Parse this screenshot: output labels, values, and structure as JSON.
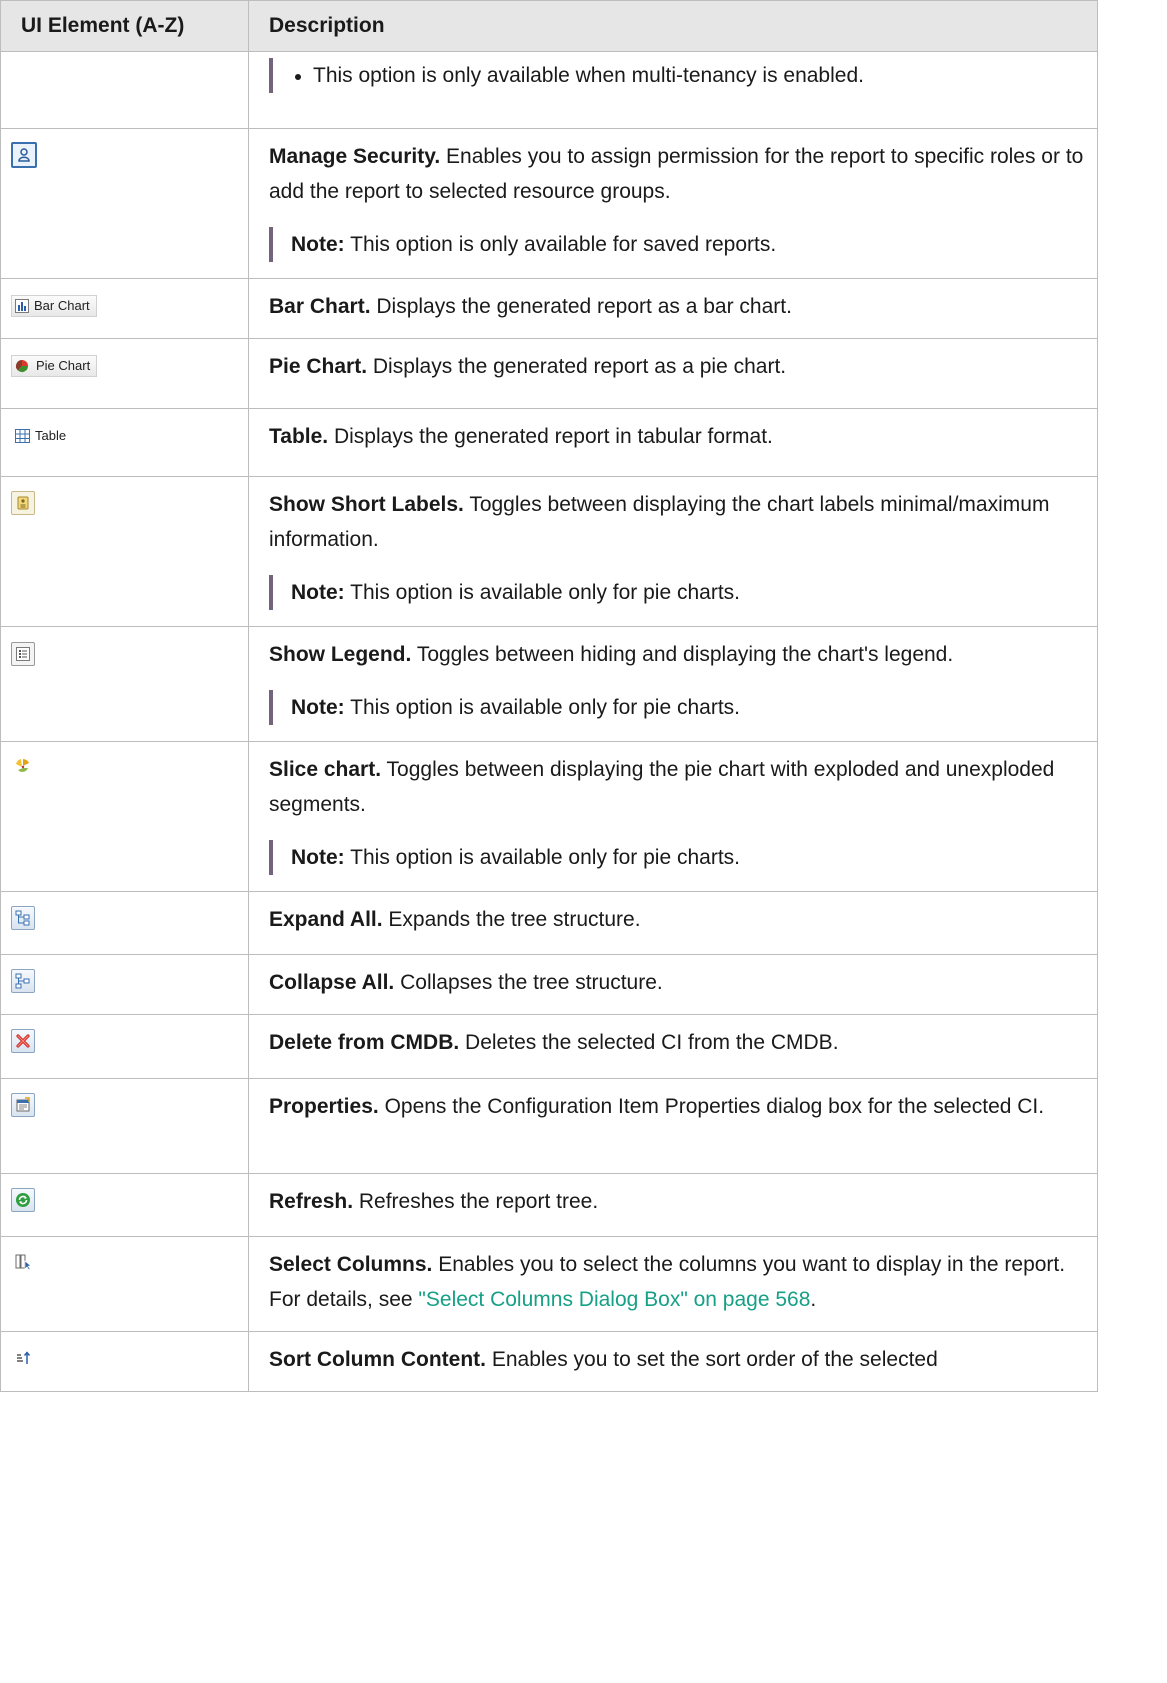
{
  "header": {
    "col1": "UI Element (A-Z)",
    "col2": "Description"
  },
  "rows": [
    {
      "note": "This option is only available when multi-tenancy is enabled."
    },
    {
      "icon": "manage-security-icon",
      "title": "Manage Security.",
      "text": "Enables you to assign permission for the report to specific roles or to add the report to selected resource groups.",
      "note_label": "Note:",
      "note": "This option is only available for saved reports."
    },
    {
      "icon": "bar-chart-icon",
      "icon_label": "Bar Chart",
      "title": "Bar Chart.",
      "text": "Displays the generated report as a bar chart."
    },
    {
      "icon": "pie-chart-icon",
      "icon_label": "Pie Chart",
      "title": "Pie Chart.",
      "text": "Displays the generated report as a pie chart."
    },
    {
      "icon": "table-icon",
      "icon_label": "Table",
      "title": "Table.",
      "text": "Displays the generated report in tabular format."
    },
    {
      "icon": "short-labels-icon",
      "title": "Show Short Labels.",
      "text": "Toggles between displaying the chart labels minimal/maximum information.",
      "note_label": "Note:",
      "note": "This option is available only for pie charts."
    },
    {
      "icon": "legend-icon",
      "title": "Show Legend.",
      "text": "Toggles between hiding and displaying the chart's legend.",
      "note_label": "Note:",
      "note": "This option is available only for pie charts."
    },
    {
      "icon": "slice-chart-icon",
      "title": "Slice chart.",
      "text": "Toggles between displaying the pie chart with exploded and unexploded segments.",
      "note_label": "Note:",
      "note": "This option is available only for pie charts."
    },
    {
      "icon": "expand-all-icon",
      "title": "Expand All.",
      "text": "Expands the tree structure."
    },
    {
      "icon": "collapse-all-icon",
      "title": "Collapse All.",
      "text": "Collapses the tree structure."
    },
    {
      "icon": "delete-icon",
      "title": "Delete from CMDB.",
      "text": "Deletes the selected CI from the CMDB."
    },
    {
      "icon": "properties-icon",
      "title": "Properties.",
      "text": "Opens the Configuration Item Properties dialog box for the selected CI."
    },
    {
      "icon": "refresh-icon",
      "title": "Refresh.",
      "text": "Refreshes the report tree."
    },
    {
      "icon": "select-columns-icon",
      "title": "Select Columns.",
      "text": "Enables you to select the columns you want to display in the report. For details, see",
      "link": "\"Select Columns Dialog Box\" on page 568",
      "text_after": "."
    },
    {
      "icon": "sort-column-icon",
      "title": "Sort Column Content.",
      "text": "Enables you to set the sort order of the selected"
    }
  ],
  "colors": {
    "header_bg": "#e6e6e6",
    "border": "#bdbdbd",
    "note_bar": "#75637d",
    "link": "#16a085"
  }
}
